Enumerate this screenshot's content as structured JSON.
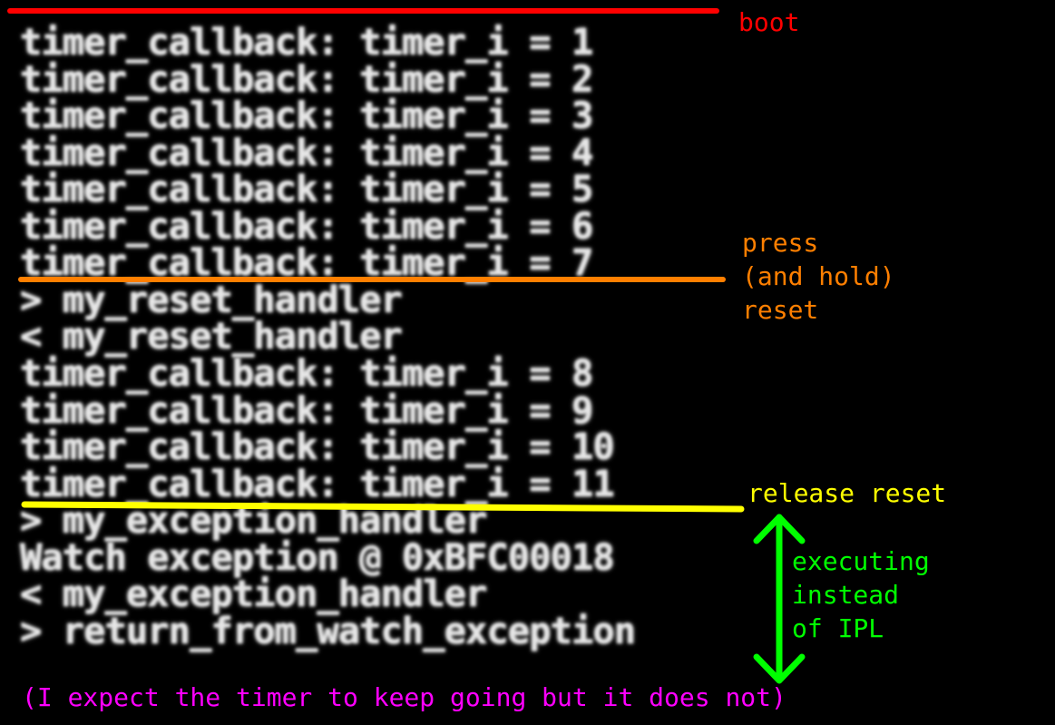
{
  "terminal": {
    "lines": [
      "timer_callback: timer_i = 1",
      "timer_callback: timer_i = 2",
      "timer_callback: timer_i = 3",
      "timer_callback: timer_i = 4",
      "timer_callback: timer_i = 5",
      "timer_callback: timer_i = 6",
      "timer_callback: timer_i = 7",
      "> my_reset_handler",
      "< my_reset_handler",
      "timer_callback: timer_i = 8",
      "timer_callback: timer_i = 9",
      "timer_callback: timer_i = 10",
      "timer_callback: timer_i = 11",
      "> my_exception_handler",
      "Watch exception @ 0xBFC00018",
      "< my_exception_handler",
      "> return_from_watch_exception"
    ]
  },
  "annotations": {
    "boot": "boot",
    "press": [
      "press",
      "(and hold)",
      "reset"
    ],
    "release": "release reset",
    "executing": [
      "executing",
      "instead",
      "of IPL"
    ],
    "expectation": "(I expect the timer to keep going but it does not)"
  },
  "colors": {
    "boot": "#ff0000",
    "press": "#ff7f00",
    "release": "#ffff00",
    "executing": "#00ff00",
    "expectation": "#ff00ff",
    "terminal_text": "#e6e6e6",
    "background": "#000000"
  }
}
